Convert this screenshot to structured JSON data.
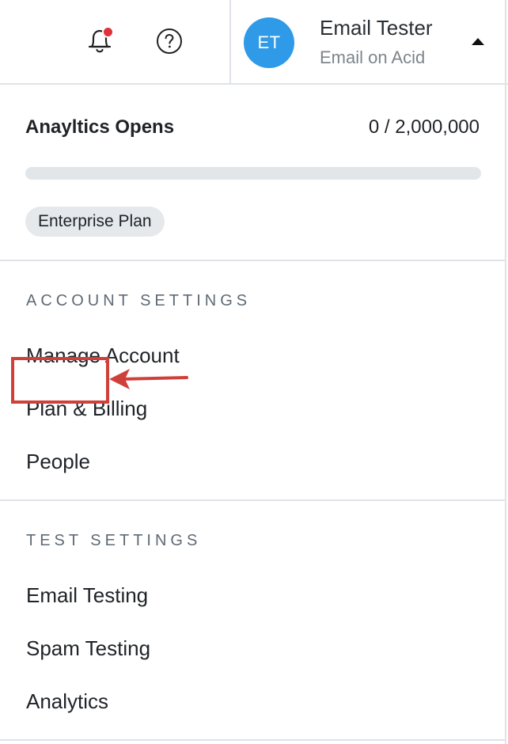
{
  "header": {
    "notifications": {
      "icon": "bell-icon",
      "has_unread": true,
      "dot_color": "#e0323a"
    },
    "help": {
      "icon": "help-circle-icon"
    },
    "user": {
      "initials": "ET",
      "name": "Email Tester",
      "organization": "Email on Acid",
      "avatar_color": "#2f9ae8",
      "menu_state_icon": "caret-up-icon"
    }
  },
  "usage": {
    "label": "Anayltics Opens",
    "value_text": "0 / 2,000,000",
    "used": 0,
    "limit": 2000000,
    "progress_fraction": 0,
    "plan": "Enterprise Plan"
  },
  "account_settings": {
    "heading": "ACCOUNT SETTINGS",
    "items": [
      {
        "label": "Manage Account"
      },
      {
        "label": "Plan & Billing"
      },
      {
        "label": "People",
        "highlighted": true
      }
    ]
  },
  "test_settings": {
    "heading": "TEST SETTINGS",
    "items": [
      {
        "label": "Email Testing"
      },
      {
        "label": "Spam Testing"
      },
      {
        "label": "Analytics"
      }
    ]
  },
  "annotation": {
    "highlight_color": "#d0403a",
    "arrow_target": "People"
  }
}
